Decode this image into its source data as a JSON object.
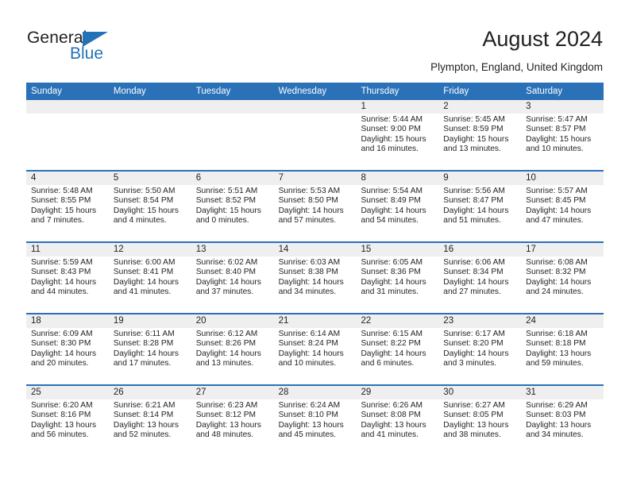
{
  "brand": {
    "name_part1": "General",
    "name_part2": "Blue",
    "accent_color": "#2272b8"
  },
  "header": {
    "title": "August 2024",
    "subtitle": "Plympton, England, United Kingdom"
  },
  "calendar": {
    "header_bg": "#2b71b8",
    "band_bg": "#efefef",
    "weekdays": [
      "Sunday",
      "Monday",
      "Tuesday",
      "Wednesday",
      "Thursday",
      "Friday",
      "Saturday"
    ],
    "weeks": [
      [
        {
          "day": ""
        },
        {
          "day": ""
        },
        {
          "day": ""
        },
        {
          "day": ""
        },
        {
          "day": "1",
          "sunrise": "Sunrise: 5:44 AM",
          "sunset": "Sunset: 9:00 PM",
          "daylight": "Daylight: 15 hours and 16 minutes."
        },
        {
          "day": "2",
          "sunrise": "Sunrise: 5:45 AM",
          "sunset": "Sunset: 8:59 PM",
          "daylight": "Daylight: 15 hours and 13 minutes."
        },
        {
          "day": "3",
          "sunrise": "Sunrise: 5:47 AM",
          "sunset": "Sunset: 8:57 PM",
          "daylight": "Daylight: 15 hours and 10 minutes."
        }
      ],
      [
        {
          "day": "4",
          "sunrise": "Sunrise: 5:48 AM",
          "sunset": "Sunset: 8:55 PM",
          "daylight": "Daylight: 15 hours and 7 minutes."
        },
        {
          "day": "5",
          "sunrise": "Sunrise: 5:50 AM",
          "sunset": "Sunset: 8:54 PM",
          "daylight": "Daylight: 15 hours and 4 minutes."
        },
        {
          "day": "6",
          "sunrise": "Sunrise: 5:51 AM",
          "sunset": "Sunset: 8:52 PM",
          "daylight": "Daylight: 15 hours and 0 minutes."
        },
        {
          "day": "7",
          "sunrise": "Sunrise: 5:53 AM",
          "sunset": "Sunset: 8:50 PM",
          "daylight": "Daylight: 14 hours and 57 minutes."
        },
        {
          "day": "8",
          "sunrise": "Sunrise: 5:54 AM",
          "sunset": "Sunset: 8:49 PM",
          "daylight": "Daylight: 14 hours and 54 minutes."
        },
        {
          "day": "9",
          "sunrise": "Sunrise: 5:56 AM",
          "sunset": "Sunset: 8:47 PM",
          "daylight": "Daylight: 14 hours and 51 minutes."
        },
        {
          "day": "10",
          "sunrise": "Sunrise: 5:57 AM",
          "sunset": "Sunset: 8:45 PM",
          "daylight": "Daylight: 14 hours and 47 minutes."
        }
      ],
      [
        {
          "day": "11",
          "sunrise": "Sunrise: 5:59 AM",
          "sunset": "Sunset: 8:43 PM",
          "daylight": "Daylight: 14 hours and 44 minutes."
        },
        {
          "day": "12",
          "sunrise": "Sunrise: 6:00 AM",
          "sunset": "Sunset: 8:41 PM",
          "daylight": "Daylight: 14 hours and 41 minutes."
        },
        {
          "day": "13",
          "sunrise": "Sunrise: 6:02 AM",
          "sunset": "Sunset: 8:40 PM",
          "daylight": "Daylight: 14 hours and 37 minutes."
        },
        {
          "day": "14",
          "sunrise": "Sunrise: 6:03 AM",
          "sunset": "Sunset: 8:38 PM",
          "daylight": "Daylight: 14 hours and 34 minutes."
        },
        {
          "day": "15",
          "sunrise": "Sunrise: 6:05 AM",
          "sunset": "Sunset: 8:36 PM",
          "daylight": "Daylight: 14 hours and 31 minutes."
        },
        {
          "day": "16",
          "sunrise": "Sunrise: 6:06 AM",
          "sunset": "Sunset: 8:34 PM",
          "daylight": "Daylight: 14 hours and 27 minutes."
        },
        {
          "day": "17",
          "sunrise": "Sunrise: 6:08 AM",
          "sunset": "Sunset: 8:32 PM",
          "daylight": "Daylight: 14 hours and 24 minutes."
        }
      ],
      [
        {
          "day": "18",
          "sunrise": "Sunrise: 6:09 AM",
          "sunset": "Sunset: 8:30 PM",
          "daylight": "Daylight: 14 hours and 20 minutes."
        },
        {
          "day": "19",
          "sunrise": "Sunrise: 6:11 AM",
          "sunset": "Sunset: 8:28 PM",
          "daylight": "Daylight: 14 hours and 17 minutes."
        },
        {
          "day": "20",
          "sunrise": "Sunrise: 6:12 AM",
          "sunset": "Sunset: 8:26 PM",
          "daylight": "Daylight: 14 hours and 13 minutes."
        },
        {
          "day": "21",
          "sunrise": "Sunrise: 6:14 AM",
          "sunset": "Sunset: 8:24 PM",
          "daylight": "Daylight: 14 hours and 10 minutes."
        },
        {
          "day": "22",
          "sunrise": "Sunrise: 6:15 AM",
          "sunset": "Sunset: 8:22 PM",
          "daylight": "Daylight: 14 hours and 6 minutes."
        },
        {
          "day": "23",
          "sunrise": "Sunrise: 6:17 AM",
          "sunset": "Sunset: 8:20 PM",
          "daylight": "Daylight: 14 hours and 3 minutes."
        },
        {
          "day": "24",
          "sunrise": "Sunrise: 6:18 AM",
          "sunset": "Sunset: 8:18 PM",
          "daylight": "Daylight: 13 hours and 59 minutes."
        }
      ],
      [
        {
          "day": "25",
          "sunrise": "Sunrise: 6:20 AM",
          "sunset": "Sunset: 8:16 PM",
          "daylight": "Daylight: 13 hours and 56 minutes."
        },
        {
          "day": "26",
          "sunrise": "Sunrise: 6:21 AM",
          "sunset": "Sunset: 8:14 PM",
          "daylight": "Daylight: 13 hours and 52 minutes."
        },
        {
          "day": "27",
          "sunrise": "Sunrise: 6:23 AM",
          "sunset": "Sunset: 8:12 PM",
          "daylight": "Daylight: 13 hours and 48 minutes."
        },
        {
          "day": "28",
          "sunrise": "Sunrise: 6:24 AM",
          "sunset": "Sunset: 8:10 PM",
          "daylight": "Daylight: 13 hours and 45 minutes."
        },
        {
          "day": "29",
          "sunrise": "Sunrise: 6:26 AM",
          "sunset": "Sunset: 8:08 PM",
          "daylight": "Daylight: 13 hours and 41 minutes."
        },
        {
          "day": "30",
          "sunrise": "Sunrise: 6:27 AM",
          "sunset": "Sunset: 8:05 PM",
          "daylight": "Daylight: 13 hours and 38 minutes."
        },
        {
          "day": "31",
          "sunrise": "Sunrise: 6:29 AM",
          "sunset": "Sunset: 8:03 PM",
          "daylight": "Daylight: 13 hours and 34 minutes."
        }
      ]
    ]
  }
}
